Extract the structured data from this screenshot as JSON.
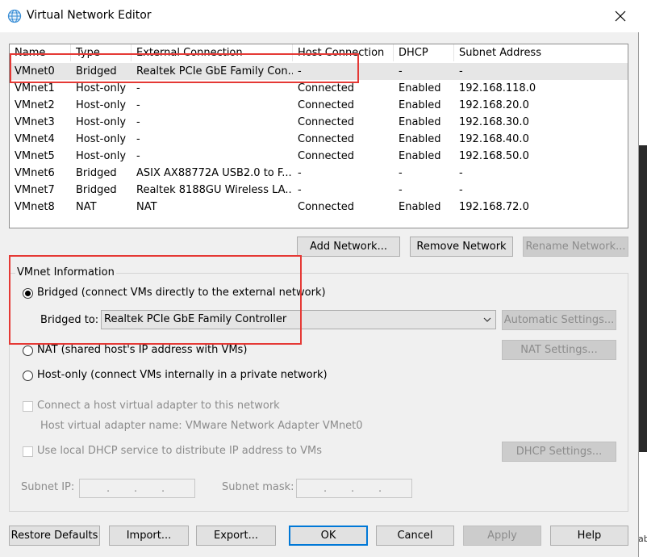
{
  "window": {
    "title": "Virtual Network Editor"
  },
  "table": {
    "headers": [
      "Name",
      "Type",
      "External Connection",
      "Host Connection",
      "DHCP",
      "Subnet Address"
    ],
    "rows": [
      [
        "VMnet0",
        "Bridged",
        "Realtek PCIe GbE Family Con...",
        "-",
        "-",
        "-"
      ],
      [
        "VMnet1",
        "Host-only",
        "-",
        "Connected",
        "Enabled",
        "192.168.118.0"
      ],
      [
        "VMnet2",
        "Host-only",
        "-",
        "Connected",
        "Enabled",
        "192.168.20.0"
      ],
      [
        "VMnet3",
        "Host-only",
        "-",
        "Connected",
        "Enabled",
        "192.168.30.0"
      ],
      [
        "VMnet4",
        "Host-only",
        "-",
        "Connected",
        "Enabled",
        "192.168.40.0"
      ],
      [
        "VMnet5",
        "Host-only",
        "-",
        "Connected",
        "Enabled",
        "192.168.50.0"
      ],
      [
        "VMnet6",
        "Bridged",
        "ASIX AX88772A USB2.0 to F...",
        "-",
        "-",
        "-"
      ],
      [
        "VMnet7",
        "Bridged",
        "Realtek 8188GU Wireless LA...",
        "-",
        "-",
        "-"
      ],
      [
        "VMnet8",
        "NAT",
        "NAT",
        "Connected",
        "Enabled",
        "192.168.72.0"
      ]
    ]
  },
  "network_buttons": {
    "add": "Add Network...",
    "remove": "Remove Network",
    "rename": "Rename Network..."
  },
  "info": {
    "group_label": "VMnet Information",
    "bridged_label": "Bridged (connect VMs directly to the external network)",
    "bridged_to_label": "Bridged to:",
    "bridged_to_value": "Realtek PCIe GbE Family Controller",
    "automatic_settings": "Automatic Settings...",
    "nat_label": "NAT (shared host's IP address with VMs)",
    "nat_settings": "NAT Settings...",
    "hostonly_label": "Host-only (connect VMs internally in a private network)",
    "connect_adapter_label": "Connect a host virtual adapter to this network",
    "adapter_name_label": "Host virtual adapter name: VMware Network Adapter VMnet0",
    "dhcp_label": "Use local DHCP service to distribute IP address to VMs",
    "dhcp_settings": "DHCP Settings...",
    "subnet_ip_label": "Subnet IP:",
    "subnet_mask_label": "Subnet mask:",
    "ip_dot": "."
  },
  "footer": {
    "restore": "Restore Defaults",
    "import": "Import...",
    "export": "Export...",
    "ok": "OK",
    "cancel": "Cancel",
    "apply": "Apply",
    "help": "Help"
  },
  "side_text": "ab",
  "colors": {
    "highlight": "#e53935",
    "focus_border": "#0078d7",
    "selected_row": "#e6e6e6"
  }
}
